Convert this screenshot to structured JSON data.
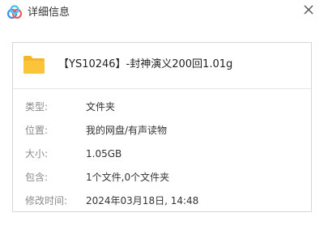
{
  "window": {
    "title": "详细信息",
    "app_icon": "baidu-netdisk-cloud-icon",
    "close_icon": "close-icon"
  },
  "file": {
    "icon": "folder-icon",
    "icon_color": "#fcc43a",
    "name": "【YS10246】-封神演义200回1.01g"
  },
  "details": [
    {
      "label": "类型:",
      "value": "文件夹"
    },
    {
      "label": "位置:",
      "value": "我的网盘/有声读物"
    },
    {
      "label": "大小:",
      "value": "1.05GB"
    },
    {
      "label": "包含:",
      "value": "1个文件,0个文件夹"
    },
    {
      "label": "修改时间:",
      "value": "2024年03月18日, 14:48"
    }
  ]
}
